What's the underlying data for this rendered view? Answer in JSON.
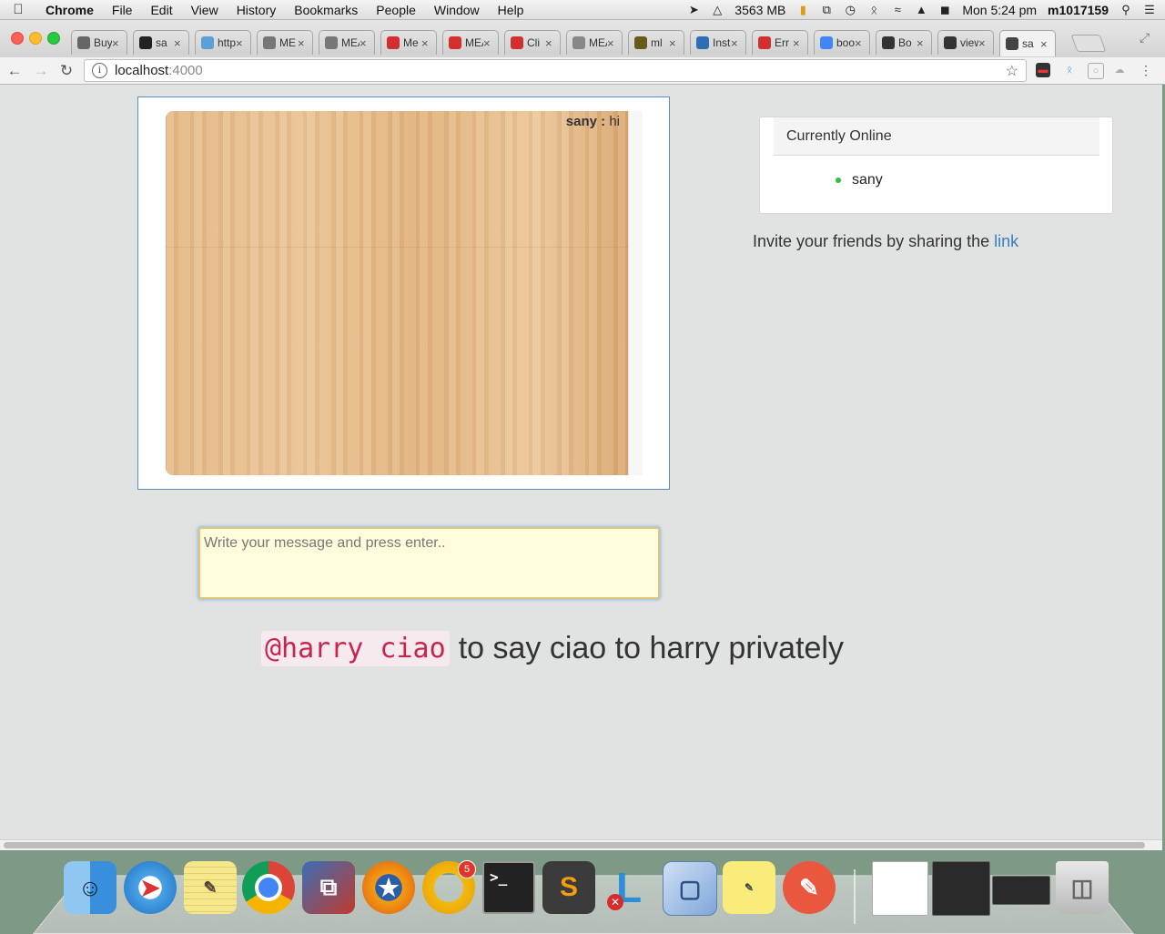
{
  "menubar": {
    "app_name": "Chrome",
    "items": [
      "File",
      "Edit",
      "View",
      "History",
      "Bookmarks",
      "People",
      "Window",
      "Help"
    ],
    "memory": "3563 MB",
    "clock": "Mon 5:24 pm",
    "user": "m1017159"
  },
  "tabs": [
    {
      "label": "Buy E",
      "icon": "rt-icon",
      "color": "#666"
    },
    {
      "label": "sa",
      "icon": "github-icon",
      "color": "#222"
    },
    {
      "label": "https",
      "icon": "cube-icon",
      "color": "#5aa0d8"
    },
    {
      "label": "ME",
      "icon": "people-icon",
      "color": "#777"
    },
    {
      "label": "MEAN",
      "icon": "people-icon",
      "color": "#777"
    },
    {
      "label": "Me",
      "icon": "youtube-icon",
      "color": "#d32f2f"
    },
    {
      "label": "MEAN",
      "icon": "youtube-icon",
      "color": "#d32f2f"
    },
    {
      "label": "Cli",
      "icon": "angular-icon",
      "color": "#d32f2f"
    },
    {
      "label": "MEAN",
      "icon": "document-icon",
      "color": "#888"
    },
    {
      "label": "ml",
      "icon": "mlab-icon",
      "color": "#6a5a1a"
    },
    {
      "label": "Instru",
      "icon": "e-icon",
      "color": "#2f6db5"
    },
    {
      "label": "Err",
      "icon": "angular-icon",
      "color": "#d32f2f"
    },
    {
      "label": "boot",
      "icon": "google-icon",
      "color": "#4285f4"
    },
    {
      "label": "Bo",
      "icon": "b-icon",
      "color": "#333"
    },
    {
      "label": "view-",
      "icon": "b-icon",
      "color": "#333"
    },
    {
      "label": "sa",
      "icon": "chat-icon",
      "color": "#444",
      "active": true
    }
  ],
  "address": {
    "host": "localhost",
    "port": ":4000"
  },
  "chat": {
    "messages": [
      {
        "user": "sany :",
        "text": " hi"
      }
    ]
  },
  "online": {
    "title": "Currently Online",
    "users": [
      "sany"
    ]
  },
  "invite": {
    "text": "Invite your friends by sharing the ",
    "link": "link"
  },
  "message_input": {
    "placeholder": "Write your message and press enter..",
    "value": ""
  },
  "hint": {
    "code": "@harry ciao",
    "text": "to say ciao to harry privately"
  },
  "dock": {
    "apps": [
      "finder-icon",
      "safari-icon",
      "notes-icon",
      "chrome-icon",
      "vmware-icon",
      "firefox-icon",
      "outlook-icon",
      "terminal-icon",
      "sublime-text-icon",
      "lync-icon",
      "virtualbox-icon",
      "stickies-icon",
      "paw-icon"
    ],
    "outlook_badge": "5"
  }
}
